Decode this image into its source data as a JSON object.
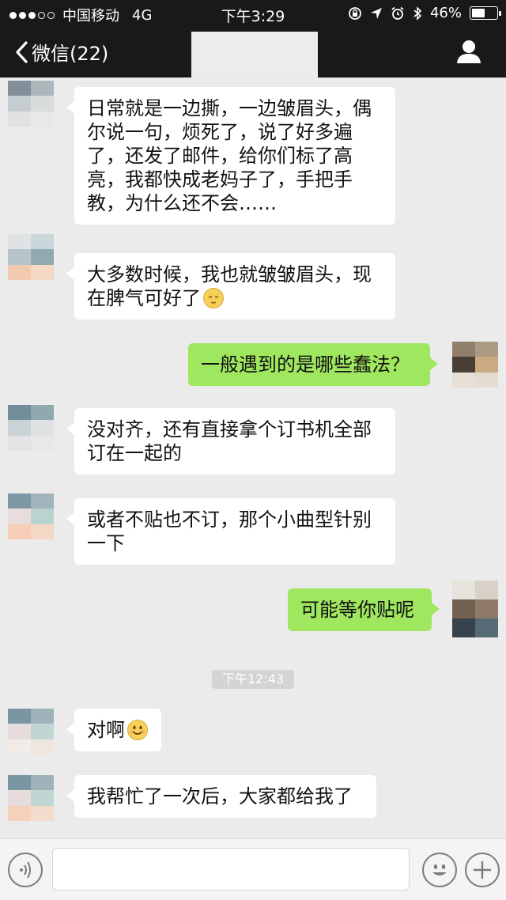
{
  "status_bar": {
    "carrier": "中国移动",
    "network": "4G",
    "time": "下午3:29",
    "battery": "46%",
    "battery_level": 0.46
  },
  "nav": {
    "back_label": "微信(22)"
  },
  "colors": {
    "incoming_bubble": "#ffffff",
    "outgoing_bubble": "#9fe75f",
    "top_bar": "#191919",
    "background": "#ebebeb"
  },
  "messages": [
    {
      "direction": "in",
      "lines": [
        "日常就是一边撕，一边皱眉头，偶",
        "尔说一句，烦死了，说了好多遍",
        "了，还发了邮件，给你们标了高",
        "亮，我都快成老妈子了，手把手",
        "教，为什么还不会……"
      ]
    },
    {
      "direction": "in",
      "lines": [
        "大多数时候，我也就皱皱眉头，现",
        "在脾气可好了"
      ],
      "emoji": "sleepy-face-emoji"
    },
    {
      "direction": "out",
      "lines": [
        "一般遇到的是哪些蠢法？"
      ]
    },
    {
      "direction": "in",
      "lines": [
        "没对齐，还有直接拿个订书机全部",
        "订在一起的"
      ]
    },
    {
      "direction": "in",
      "lines": [
        "或者不贴也不订，那个小曲型针别",
        "一下"
      ]
    },
    {
      "direction": "out",
      "lines": [
        "可能等你贴呢"
      ]
    },
    {
      "direction": "in",
      "lines": [
        "对啊"
      ],
      "emoji": "smile-face-emoji"
    },
    {
      "direction": "in",
      "lines": [
        "我帮忙了一次后，大家都给我了"
      ]
    }
  ],
  "timestamp": "下午12:43",
  "bottom_bar": {
    "voice_icon": "voice-icon",
    "emoji_icon": "emoji-icon",
    "plus_icon": "plus-icon",
    "input_value": ""
  }
}
